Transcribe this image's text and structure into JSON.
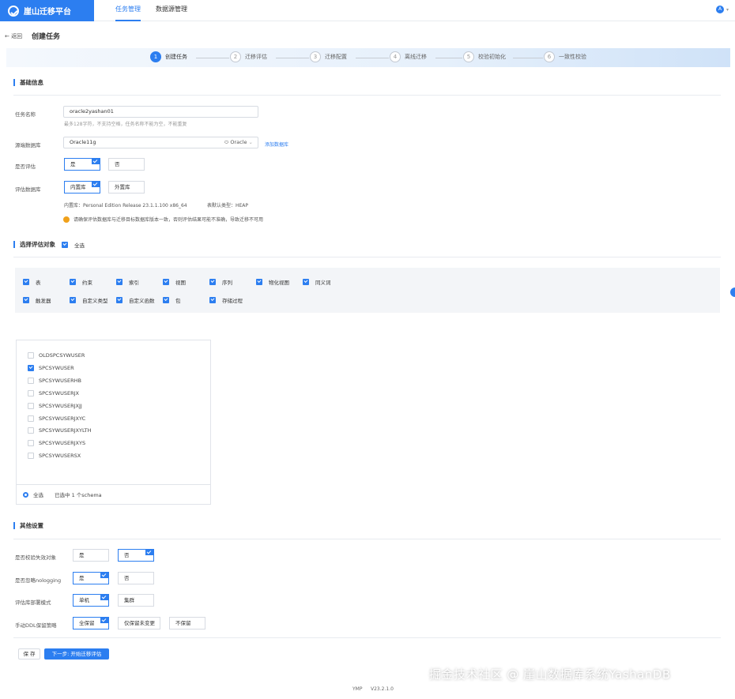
{
  "app": {
    "name": "崖山迁移平台"
  },
  "nav": [
    "任务管理",
    "数据源管理"
  ],
  "user": {
    "initial": "A"
  },
  "header": {
    "back": "← 返回",
    "title": "创建任务"
  },
  "steps": [
    {
      "num": "1",
      "label": "创建任务"
    },
    {
      "num": "2",
      "label": "迁移评估"
    },
    {
      "num": "3",
      "label": "迁移配置"
    },
    {
      "num": "4",
      "label": "离线迁移"
    },
    {
      "num": "5",
      "label": "校验初始化"
    },
    {
      "num": "6",
      "label": "一致性校验"
    }
  ],
  "basic": {
    "title": "基础信息",
    "task_name_label": "任务名称",
    "task_name_value": "oracle2yashan01",
    "task_name_hint": "最多128字符，不支持空格，任务名称不能为空，不能重复",
    "source_db_label": "源端数据库",
    "source_db_value": "Oracle11g",
    "source_db_type": "Oracle",
    "add_db_link": "添加数据库",
    "evaluate_label": "是否评估",
    "evaluate_yes": "是",
    "evaluate_no": "否",
    "eval_db_label": "评估数据库",
    "eval_db_internal": "内置库",
    "eval_db_external": "外置库",
    "internal_info": "内置库：Personal Edition Release 23.1.1.100 x86_64",
    "table_type_info": "表默认类型：HEAP",
    "warning": "请确保评估数据库与迁移目标数据库版本一致，否则评估结果可能不准确，导致迁移不可用"
  },
  "objects": {
    "title": "选择评估对象",
    "select_all": "全选",
    "items": [
      "表",
      "约束",
      "索引",
      "视图",
      "序列",
      "物化视图",
      "同义词",
      "触发器",
      "自定义类型",
      "自定义函数",
      "包",
      "存储过程"
    ]
  },
  "schemas": {
    "items": [
      {
        "name": "OLDSPCSYWUSER",
        "checked": false
      },
      {
        "name": "SPCSYWUSER",
        "checked": true
      },
      {
        "name": "SPCSYWUSERHB",
        "checked": false
      },
      {
        "name": "SPCSYWUSERJX",
        "checked": false
      },
      {
        "name": "SPCSYWUSERJXJJ",
        "checked": false
      },
      {
        "name": "SPCSYWUSERJXYC",
        "checked": false
      },
      {
        "name": "SPCSYWUSERJXYLTH",
        "checked": false
      },
      {
        "name": "SPCSYWUSERJXYS",
        "checked": false
      },
      {
        "name": "SPCSYWUSERSX",
        "checked": false
      }
    ],
    "footer_all": "全选",
    "footer_count": "已选中 1 个schema"
  },
  "other": {
    "title": "其他设置",
    "rows": [
      {
        "label": "是否校验失效对象",
        "opts": [
          "是",
          "否"
        ],
        "selected": 1
      },
      {
        "label": "是否忽略nologging",
        "opts": [
          "是",
          "否"
        ],
        "selected": 0
      },
      {
        "label": "评估库部署模式",
        "opts": [
          "单机",
          "集群"
        ],
        "selected": 0
      },
      {
        "label": "手动DDL保留策略",
        "opts": [
          "全保留",
          "仅保留未变更",
          "不保留"
        ],
        "selected": 0
      }
    ]
  },
  "actions": {
    "save": "保 存",
    "next": "下一步: 开始迁移评估"
  },
  "footer": {
    "product": "YMP",
    "version": "V23.2.1.0"
  },
  "watermark": "掘金技术社区 @ 崖山数据库系统YashanDB",
  "colors": {
    "primary": "#2c7ef0",
    "warning": "#f0a11b"
  }
}
